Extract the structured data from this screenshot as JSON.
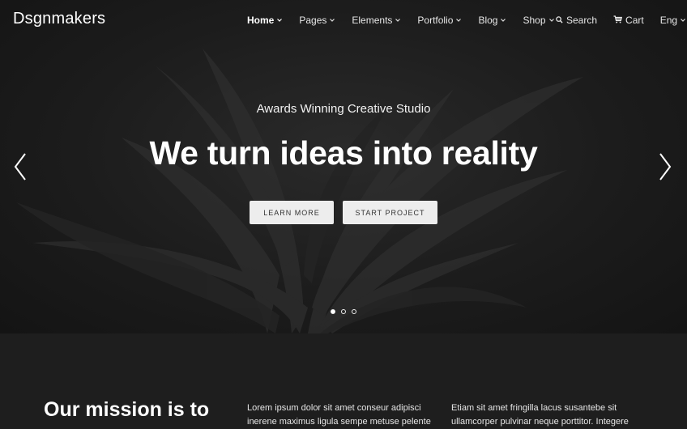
{
  "brand": {
    "logo_text": "Dsgnmakers"
  },
  "nav": {
    "items": [
      {
        "label": "Home",
        "active": true
      },
      {
        "label": "Pages",
        "active": false
      },
      {
        "label": "Elements",
        "active": false
      },
      {
        "label": "Portfolio",
        "active": false
      },
      {
        "label": "Blog",
        "active": false
      },
      {
        "label": "Shop",
        "active": false
      }
    ],
    "search_label": "Search",
    "cart_label": "Cart",
    "language_label": "Eng"
  },
  "hero": {
    "subtitle": "Awards Winning Creative Studio",
    "headline": "We turn ideas into reality",
    "learn_more_label": "LEARN MORE",
    "start_project_label": "START PROJECT",
    "slides_count": 3,
    "active_slide": 1
  },
  "mission": {
    "title": "Our mission is to",
    "col1_text": "Lorem ipsum dolor sit amet conseur adipisci inerene maximus ligula sempe metuse pelente",
    "col2_text": "Etiam sit amet fringilla lacus susantebe sit ullamcorper pulvinar neque porttitor. Integere"
  },
  "colors": {
    "hero_background": "#1c1c1c",
    "section_background": "#1e1e1e",
    "button_background": "#ededed",
    "text_primary": "#ffffff"
  },
  "icons": {
    "search": "search-icon",
    "cart": "cart-icon",
    "caret": "chevron-down-icon",
    "prev": "chevron-left-icon",
    "next": "chevron-right-icon"
  }
}
